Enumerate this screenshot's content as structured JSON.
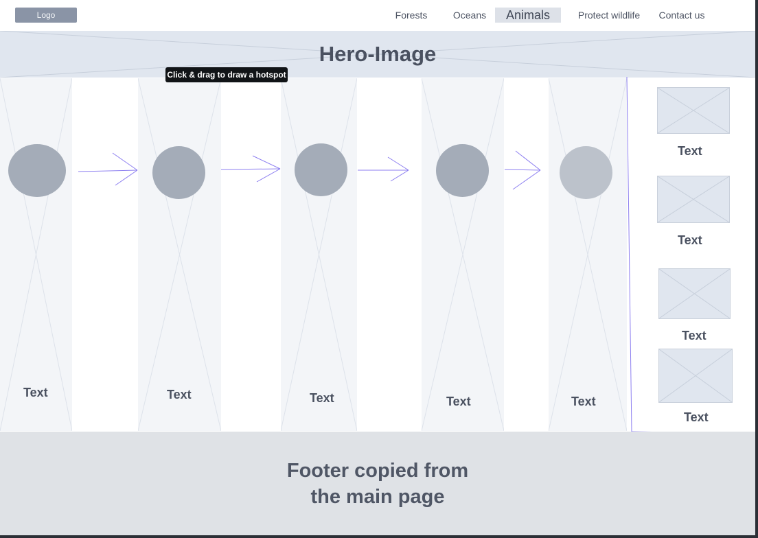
{
  "header": {
    "logo": "Logo",
    "nav": [
      "Forests",
      "Oceans",
      "Animals",
      "Protect wildlife",
      "Contact us"
    ],
    "active": "Animals"
  },
  "hero": {
    "title": "Hero-Image"
  },
  "tooltip": {
    "text": "Click & drag to draw a hotspot"
  },
  "steps": [
    {
      "label": "Text"
    },
    {
      "label": "Text"
    },
    {
      "label": "Text"
    },
    {
      "label": "Text"
    },
    {
      "label": "Text"
    }
  ],
  "sidebar": {
    "items": [
      {
        "label": "Text"
      },
      {
        "label": "Text"
      },
      {
        "label": "Text"
      },
      {
        "label": "Text"
      }
    ]
  },
  "footer": {
    "line1": "Footer copied from",
    "line2": "the main page"
  },
  "colors": {
    "placeholder_fill": "#e0e6ef",
    "circle": "#a4acb8",
    "accent_line": "#8c7ef0",
    "footer_bg": "#dfe2e6"
  }
}
